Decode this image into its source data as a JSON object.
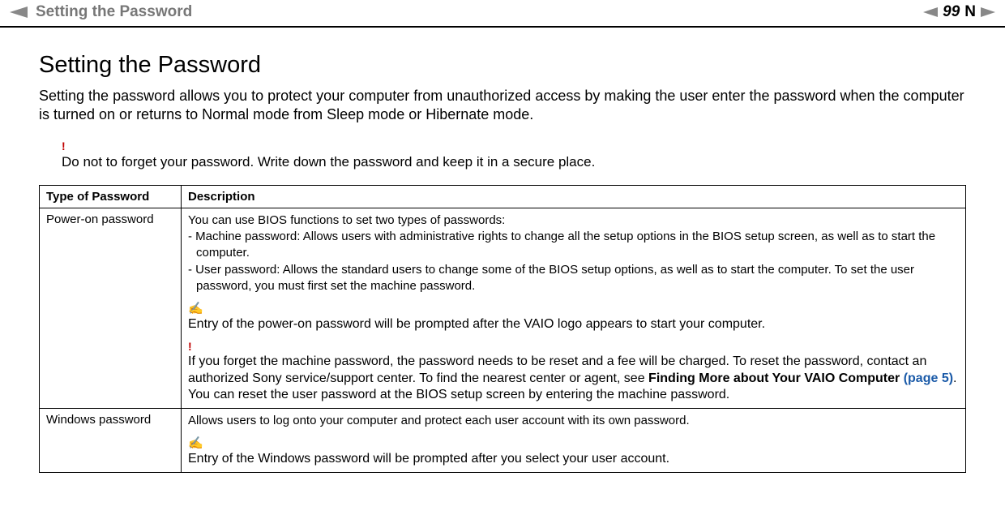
{
  "header": {
    "breadcrumb": "Setting the Password",
    "page_number": "99",
    "capital_n": "N"
  },
  "main": {
    "heading": "Setting the Password",
    "intro": "Setting the password allows you to protect your computer from unauthorized access by making the user enter the password when the computer is turned on or returns to Normal mode from Sleep mode or Hibernate mode.",
    "warning": {
      "mark": "!",
      "text": "Do not to forget your password. Write down the password and keep it in a secure place."
    },
    "table": {
      "headers": {
        "type": "Type of Password",
        "description": "Description"
      },
      "rows": {
        "poweron": {
          "type": "Power-on password",
          "intro": "You can use BIOS functions to set two types of passwords:",
          "machine": "- Machine password: Allows users with administrative rights to change all the setup options in the BIOS setup screen, as well as to start the computer.",
          "user": "- User password: Allows the standard users to change some of the BIOS setup options, as well as to start the computer. To set the user password, you must first set the machine password.",
          "note_mark": "✍",
          "note": "Entry of the power-on password will be prompted after the VAIO logo appears to start your computer.",
          "warn_mark": "!",
          "warn_line1": "If you forget the machine password, the password needs to be reset and a fee will be charged. To reset the password, contact an authorized Sony service/support center. To find the nearest center or agent, see ",
          "warn_bold": "Finding More about Your VAIO Computer ",
          "warn_pageref": "(page 5)",
          "warn_period": ".",
          "warn_line2": "You can reset the user password at the BIOS setup screen by entering the machine password."
        },
        "windows": {
          "type": "Windows password",
          "intro": "Allows users to log onto your computer and protect each user account with its own password.",
          "note_mark": "✍",
          "note": "Entry of the Windows password will be prompted after you select your user account."
        }
      }
    }
  }
}
